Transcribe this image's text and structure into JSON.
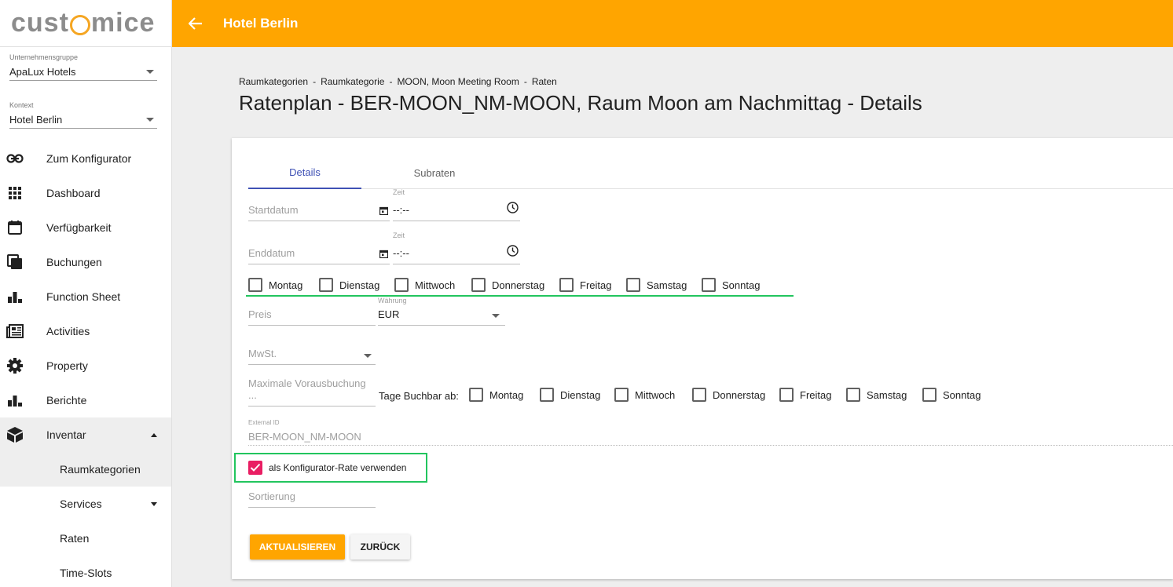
{
  "brand": {
    "logo_left": "cust",
    "logo_right": "mice"
  },
  "sidebar": {
    "group_caption": "Unternehmensgruppe",
    "group_value": "ApaLux Hotels",
    "context_caption": "Kontext",
    "context_value": "Hotel Berlin",
    "items": [
      {
        "label": "Zum Konfigurator",
        "icon": "link-icon"
      },
      {
        "label": "Dashboard",
        "icon": "grid-icon"
      },
      {
        "label": "Verfügbarkeit",
        "icon": "calendar-icon"
      },
      {
        "label": "Buchungen",
        "icon": "copy-icon"
      },
      {
        "label": "Function Sheet",
        "icon": "bar-chart-icon"
      },
      {
        "label": "Activities",
        "icon": "newspaper-icon"
      },
      {
        "label": "Property",
        "icon": "gear-icon"
      },
      {
        "label": "Berichte",
        "icon": "bar-chart-icon"
      },
      {
        "label": "Inventar",
        "icon": "box-icon"
      }
    ],
    "subitems": [
      {
        "label": "Raumkategorien"
      },
      {
        "label": "Services"
      },
      {
        "label": "Raten"
      },
      {
        "label": "Time-Slots"
      }
    ]
  },
  "header": {
    "title": "Hotel Berlin"
  },
  "breadcrumb": [
    "Raumkategorien",
    "Raumkategorie",
    "MOON, Moon Meeting Room",
    "Raten"
  ],
  "page_title": "Ratenplan - BER-MOON_NM-MOON, Raum Moon am Nachmittag - Details",
  "tabs": [
    "Details",
    "Subraten"
  ],
  "form": {
    "start_placeholder": "Startdatum",
    "end_placeholder": "Enddatum",
    "time_caption": "Zeit",
    "time_placeholder": "--:--",
    "weekdays": [
      "Montag",
      "Dienstag",
      "Mittwoch",
      "Donnerstag",
      "Freitag",
      "Samstag",
      "Sonntag"
    ],
    "price_placeholder": "Preis",
    "currency_caption": "Währung",
    "currency_value": "EUR",
    "vat_placeholder": "MwSt.",
    "max_advance_placeholder": "Maximale Vorausbuchung ...",
    "bookable_days_label": "Tage Buchbar ab:",
    "external_id_caption": "External ID",
    "external_id_value": "BER-MOON_NM-MOON",
    "configurator_rate_label": "als Konfigurator-Rate verwenden",
    "sort_placeholder": "Sortierung",
    "update_button": "AKTUALISIEREN",
    "back_button": "ZURÜCK"
  },
  "colors": {
    "accent": "#ffa500",
    "tab_active": "#3f51b5",
    "checkbox_on": "#e91e63",
    "annotation": "#22c55e"
  }
}
